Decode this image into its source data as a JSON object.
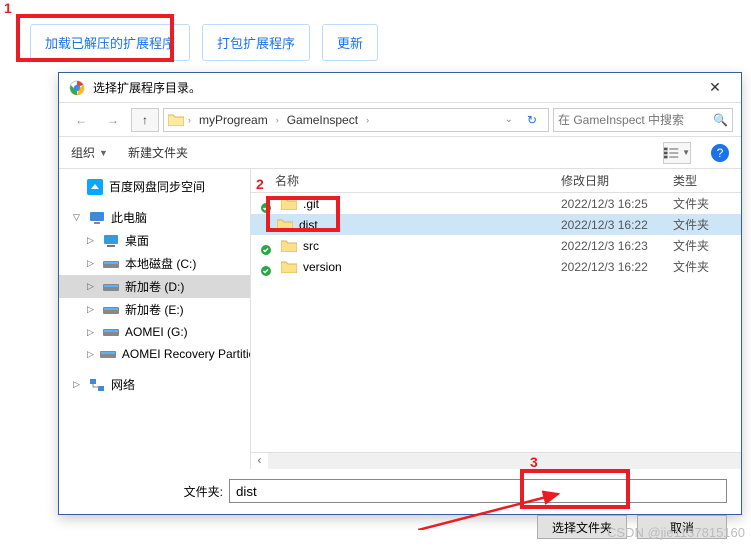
{
  "toolbar": {
    "load_unpacked": "加载已解压的扩展程序",
    "pack": "打包扩展程序",
    "update": "更新"
  },
  "dialog": {
    "title": "选择扩展程序目录。",
    "breadcrumb": [
      "myProgream",
      "GameInspect"
    ],
    "search_placeholder": "在 GameInspect 中搜索",
    "organize": "组织",
    "new_folder": "新建文件夹",
    "columns": {
      "name": "名称",
      "date": "修改日期",
      "type": "类型"
    },
    "tree": {
      "baidu": "百度网盘同步空间",
      "thispc": "此电脑",
      "desktop": "桌面",
      "drive_c": "本地磁盘 (C:)",
      "drive_d": "新加卷 (D:)",
      "drive_e": "新加卷 (E:)",
      "drive_g": "AOMEI (G:)",
      "drive_aomei": "AOMEI Recovery Partition",
      "network": "网络"
    },
    "files": [
      {
        "name": ".git",
        "date": "2022/12/3 16:25",
        "type": "文件夹",
        "badge": "green"
      },
      {
        "name": "dist",
        "date": "2022/12/3 16:22",
        "type": "文件夹",
        "badge": "none",
        "selected": true
      },
      {
        "name": "src",
        "date": "2022/12/3 16:23",
        "type": "文件夹",
        "badge": "green"
      },
      {
        "name": "version",
        "date": "2022/12/3 16:22",
        "type": "文件夹",
        "badge": "green"
      }
    ],
    "folder_label": "文件夹:",
    "folder_value": "dist",
    "select_btn": "选择文件夹",
    "cancel_btn": "取消"
  },
  "annotations": {
    "a1": "1",
    "a2": "2",
    "a3": "3"
  },
  "watermark": "CSDN @jie1137815160"
}
